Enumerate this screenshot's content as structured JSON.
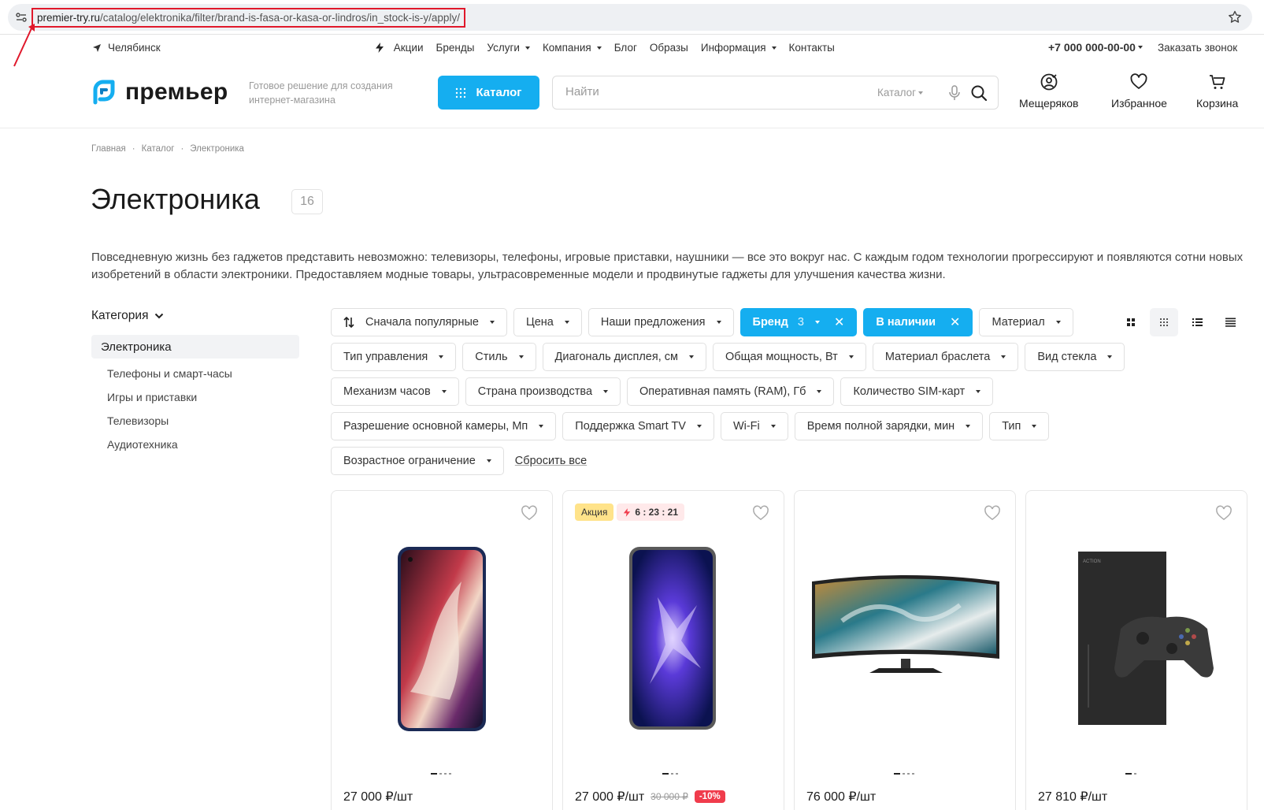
{
  "browser": {
    "url_host": "premier-try.ru",
    "url_path": "/catalog/elektronika/filter/brand-is-fasa-or-kasa-or-lindros/in_stock-is-y/apply/"
  },
  "topbar": {
    "city": "Челябинск",
    "nav": [
      {
        "label": "Акции",
        "has_icon": true
      },
      {
        "label": "Бренды"
      },
      {
        "label": "Услуги",
        "dropdown": true
      },
      {
        "label": "Компания",
        "dropdown": true
      },
      {
        "label": "Блог"
      },
      {
        "label": "Образы"
      },
      {
        "label": "Информация",
        "dropdown": true
      },
      {
        "label": "Контакты"
      }
    ],
    "phone": "+7 000 000-00-00",
    "callback": "Заказать звонок"
  },
  "header": {
    "logo_text": "премьер",
    "tagline": "Готовое решение для создания интернет-магазина",
    "catalog_button": "Каталог",
    "search_placeholder": "Найти",
    "search_scope": "Каталог",
    "profile_label": "Мещеряков",
    "favorites_label": "Избранное",
    "cart_label": "Корзина"
  },
  "breadcrumb": [
    "Главная",
    "Каталог",
    "Электроника"
  ],
  "page": {
    "title": "Электроника",
    "count": "16",
    "description": "Повседневную жизнь без гаджетов представить невозможно: телевизоры, телефоны, игровые приставки, наушники — все это вокруг нас. С каждым годом технологии прогрессируют и появляются сотни новых изобретений в области электроники. Предоставляем модные товары, ультрасовременные модели и продвинутые гаджеты для улучшения качества жизни."
  },
  "sidebar": {
    "heading": "Категория",
    "active": "Электроника",
    "items": [
      "Телефоны и смарт-часы",
      "Игры и приставки",
      "Телевизоры",
      "Аудиотехника"
    ]
  },
  "filters": {
    "sort": "Сначала популярные",
    "chips": [
      "Цена",
      "Наши предложения",
      "Материал",
      "Тип управления",
      "Стиль",
      "Диагональ дисплея, см",
      "Общая мощность, Вт",
      "Материал браслета",
      "Вид стекла",
      "Механизм часов",
      "Страна производства",
      "Оперативная память (RAM), Гб",
      "Количество SIM-карт",
      "Разрешение основной камеры, Мп",
      "Поддержка Smart TV",
      "Wi-Fi",
      "Время полной зарядки, мин",
      "Тип",
      "Возрастное ограничение"
    ],
    "brand_chip": "Бренд",
    "brand_count": "3",
    "stock_chip": "В наличии",
    "reset": "Сбросить все"
  },
  "products": [
    {
      "price": "27 000 ₽/шт",
      "old_price": "",
      "discount": "",
      "sale_badge": "",
      "timer": ""
    },
    {
      "price": "27 000 ₽/шт",
      "old_price": "30 000 ₽",
      "discount": "-10%",
      "sale_badge": "Акция",
      "timer": "6 : 23 : 21"
    },
    {
      "price": "76 000 ₽/шт",
      "old_price": "",
      "discount": "",
      "sale_badge": "",
      "timer": ""
    },
    {
      "price": "27 810 ₽/шт",
      "old_price": "",
      "discount": "",
      "sale_badge": "",
      "timer": "",
      "image_text": "ACTION"
    }
  ],
  "colors": {
    "accent": "#15aef0",
    "discount": "#f03c4c",
    "sale_badge": "#ffe38a",
    "url_highlight": "#e0182b"
  }
}
